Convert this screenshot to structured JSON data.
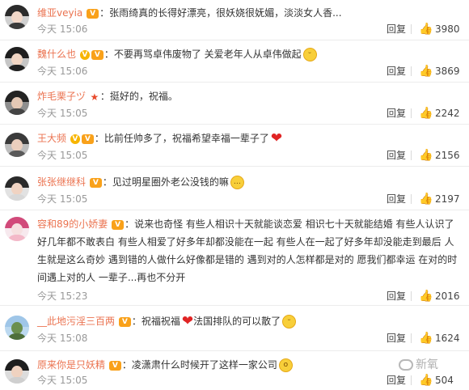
{
  "comments": [
    {
      "user": "维亚veyia",
      "badge": "vip",
      "text": "：张雨绮真的长得好漂亮，很妖娆很妩媚，淡淡女人香...",
      "emoji": "",
      "time": "今天 15:06",
      "reply": "回复",
      "likes": "3980",
      "avatar_colors": {
        "hair": "#2b2b2b",
        "face": "#f2d8c9",
        "body": "#3a3a3a",
        "bg": "#d0d0d0"
      }
    },
    {
      "user": "魏什么也",
      "badge": "v",
      "badge2": "vip",
      "text": "：不要再骂卓伟废物了 关爱老年人从卓伟做起",
      "emoji": "smile-emoji",
      "time": "今天 15:06",
      "reply": "回复",
      "likes": "3869",
      "avatar_colors": {
        "hair": "#1f1f1f",
        "face": "#f1d6c4",
        "body": "#202020",
        "bg": "#c6c6c6"
      }
    },
    {
      "user": "炸毛栗子ヅ",
      "badge": "star",
      "text": "：挺好的，祝福。",
      "emoji": "",
      "time": "今天 15:05",
      "reply": "回复",
      "likes": "2242",
      "avatar_colors": {
        "hair": "#232323",
        "face": "#e4c8b5",
        "body": "#444444",
        "bg": "#8e8e8e"
      }
    },
    {
      "user": "王大频",
      "badge": "v",
      "badge2": "vip",
      "text": "：比前任帅多了，祝福希望幸福一辈子了",
      "emoji": "heart",
      "time": "今天 15:05",
      "reply": "回复",
      "likes": "2156",
      "avatar_colors": {
        "hair": "#3a3a3a",
        "face": "#ebcfbe",
        "body": "#5a5a5a",
        "bg": "#bdbdbd"
      }
    },
    {
      "user": "张张继继科",
      "badge": "vip",
      "text": "：见过明星圈外老公没钱的嘛",
      "emoji": "think-emoji",
      "time": "今天 15:05",
      "reply": "回复",
      "likes": "2197",
      "avatar_colors": {
        "hair": "#2a2a2a",
        "face": "#f0d3c2",
        "body": "#d8d8d8",
        "bg": "#e2e2e2"
      }
    },
    {
      "user": "容和89的小娇妻",
      "badge": "vip",
      "text": "：说来也奇怪 有些人相识十天就能谈恋爱 相识七十天就能结婚 有些人认识了好几年都不敢表白 有些人相爱了好多年却都没能在一起 有些人在一起了好多年却没能走到最后 人生就是这么奇妙 遇到错的人做什么好像都是错的 遇到对的人怎样都是对的 愿我们都幸运 在对的时间遇上对的人 一辈子...再也不分开",
      "emoji": "",
      "time": "今天 15:23",
      "reply": "回复",
      "likes": "2016",
      "avatar_colors": {
        "hair": "#d14a7a",
        "face": "#f6e0e0",
        "body": "#f3b8c8",
        "bg": "#f7e9ee"
      }
    },
    {
      "user": "__此地污淫三百两",
      "badge": "vip",
      "text": "：祝福祝福",
      "text2": "法国排队的可以散了",
      "emoji": "heart",
      "emoji2": "smile-emoji",
      "time": "今天 15:08",
      "reply": "回复",
      "likes": "1624",
      "avatar_colors": {
        "hair": "#9fc6e8",
        "face": "#6b8f4e",
        "body": "#4e6f3a",
        "bg": "#bcd9f0"
      }
    },
    {
      "user": "原来你是只妖精",
      "badge": "vip",
      "text": "：凌潇肃什么时候开了这样一家公司",
      "emoji": "shock-emoji",
      "time": "今天 15:05",
      "reply": "回复",
      "likes": "504",
      "avatar_colors": {
        "hair": "#1e1e1e",
        "face": "#efd2c0",
        "body": "#cfcfcf",
        "bg": "#dcdcdc"
      }
    }
  ],
  "watermark": "新氧",
  "icons": {
    "like": "thumbs-up-icon",
    "watermark": "wechat-icon"
  },
  "colors": {
    "username": "#eb7350",
    "time": "#999999",
    "badge_vip": "#f9a11a"
  }
}
